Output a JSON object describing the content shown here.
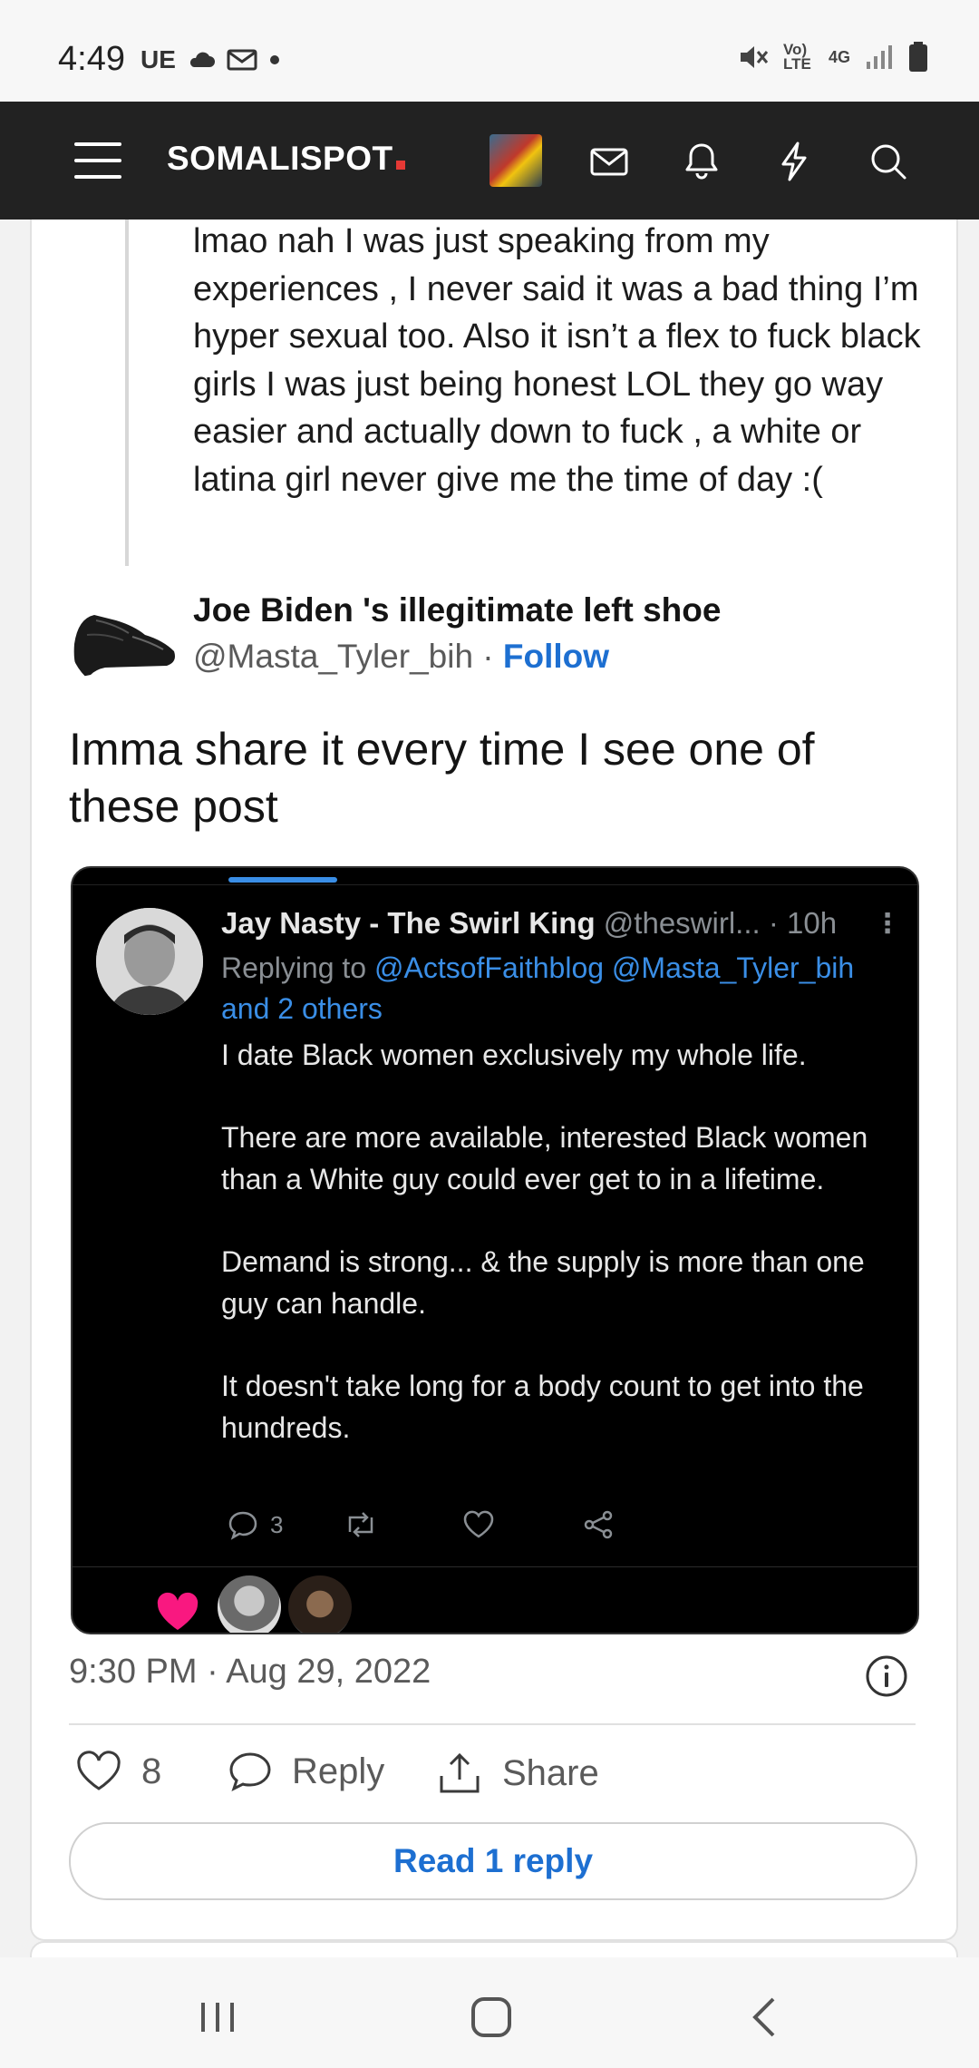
{
  "status_bar": {
    "time": "4:49",
    "carrier": "UE",
    "network_label": "4G",
    "volte_label": "Vo) LTE"
  },
  "app_bar": {
    "logo": "SOMALISPOT",
    "icons": [
      "menu-icon",
      "avatar",
      "mail-icon",
      "bell-icon",
      "bolt-icon",
      "search-icon"
    ]
  },
  "quoted_post": {
    "text": "lmao nah I was just speaking from my experiences , I never said it was a bad thing I’m hyper sexual too. Also it isn’t a flex to fuck black girls I was just being honest LOL they go way easier and actually down to fuck , a white or latina girl never give me the time of day :("
  },
  "post": {
    "author_name": "Joe Biden 's illegitimate left shoe",
    "author_handle": "@Masta_Tyler_bih",
    "separator": " · ",
    "follow_label": "Follow",
    "text": "Imma share it every time I see one of these post",
    "timestamp": "9:30 PM · Aug 29, 2022",
    "likes": "8",
    "reply_label": "Reply",
    "share_label": "Share",
    "read_replies_label": "Read 1 reply"
  },
  "embedded_tweet": {
    "name": "Jay Nasty - The Swirl King",
    "handle": "@theswirl...",
    "time": "· 10h",
    "replying_prefix": "Replying to",
    "replying_to": "@ActsofFaithblog @Masta_Tyler_bih",
    "replying_others": "and 2 others",
    "paragraphs": [
      "I date Black women exclusively my whole life.",
      "There are more available, interested Black women than a White guy could ever get to in a lifetime.",
      "Demand is strong... & the supply is more than one guy can handle.",
      "It doesn't take long for a body count to get into the hundreds."
    ],
    "reply_count": "3"
  },
  "colors": {
    "accent": "#1d6fd1",
    "app_bar_bg": "#222222",
    "logo_dot": "#e53935",
    "embed_bg": "#000000",
    "embed_link": "#3a8ee6",
    "heart_pink": "#f91880"
  }
}
